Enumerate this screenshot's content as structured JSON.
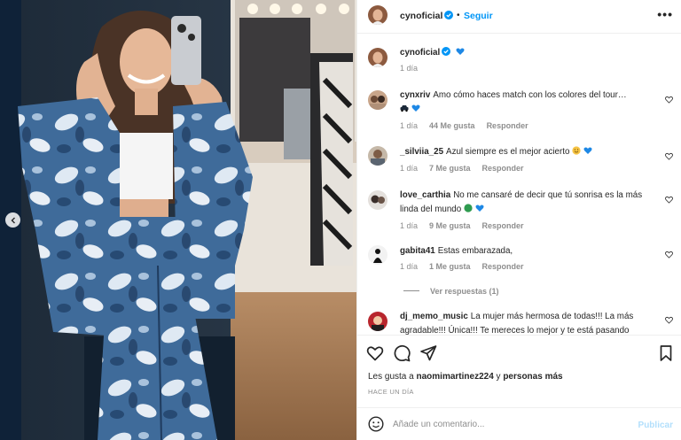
{
  "post": {
    "author": "cynoficial",
    "follow_label": "Seguir",
    "more_label": "•••",
    "dot": "•",
    "caption_time": "1 día",
    "caption_emoji": "blue-heart-icon"
  },
  "comments": [
    {
      "user": "cynxriv",
      "text": "Amo cómo haces match con los colores del tour…",
      "time": "1 día",
      "likes": "44 Me gusta",
      "reply": "Responder",
      "emojis": [
        "car-icon",
        "blue-heart-icon"
      ]
    },
    {
      "user": "_silviia_25",
      "text": "Azul siempre es el mejor acierto",
      "time": "1 día",
      "likes": "7 Me gusta",
      "reply": "Responder",
      "emojis": [
        "smiling-face-icon",
        "blue-heart-icon"
      ]
    },
    {
      "user": "love_carthia",
      "text": "No me cansaré de decir que tú sonrisa es la más linda del mundo",
      "time": "1 día",
      "likes": "9 Me gusta",
      "reply": "Responder",
      "emojis": [
        "green-circle-icon",
        "blue-heart-icon"
      ]
    },
    {
      "user": "gabita41",
      "text": "Estas embarazada,",
      "time": "1 día",
      "likes": "1 Me gusta",
      "reply": "Responder"
    },
    {
      "user": "dj_memo_music",
      "text": "La mujer más hermosa de todas!!! La más agradable!!! Única!!! Te mereces lo mejor y te está pasando"
    }
  ],
  "view_replies": "Ver respuestas (1)",
  "likes_line": {
    "prefix": "Les gusta a",
    "user": "naomimartinez224",
    "middle": "y",
    "suffix": "personas más"
  },
  "timestamp": "HACE UN DÍA",
  "add_comment": {
    "placeholder": "Añade un comentario...",
    "publish": "Publicar"
  },
  "colors": {
    "accent": "#0095f6",
    "publish_disabled": "#b2dffc",
    "muted": "#8e8e8e"
  }
}
